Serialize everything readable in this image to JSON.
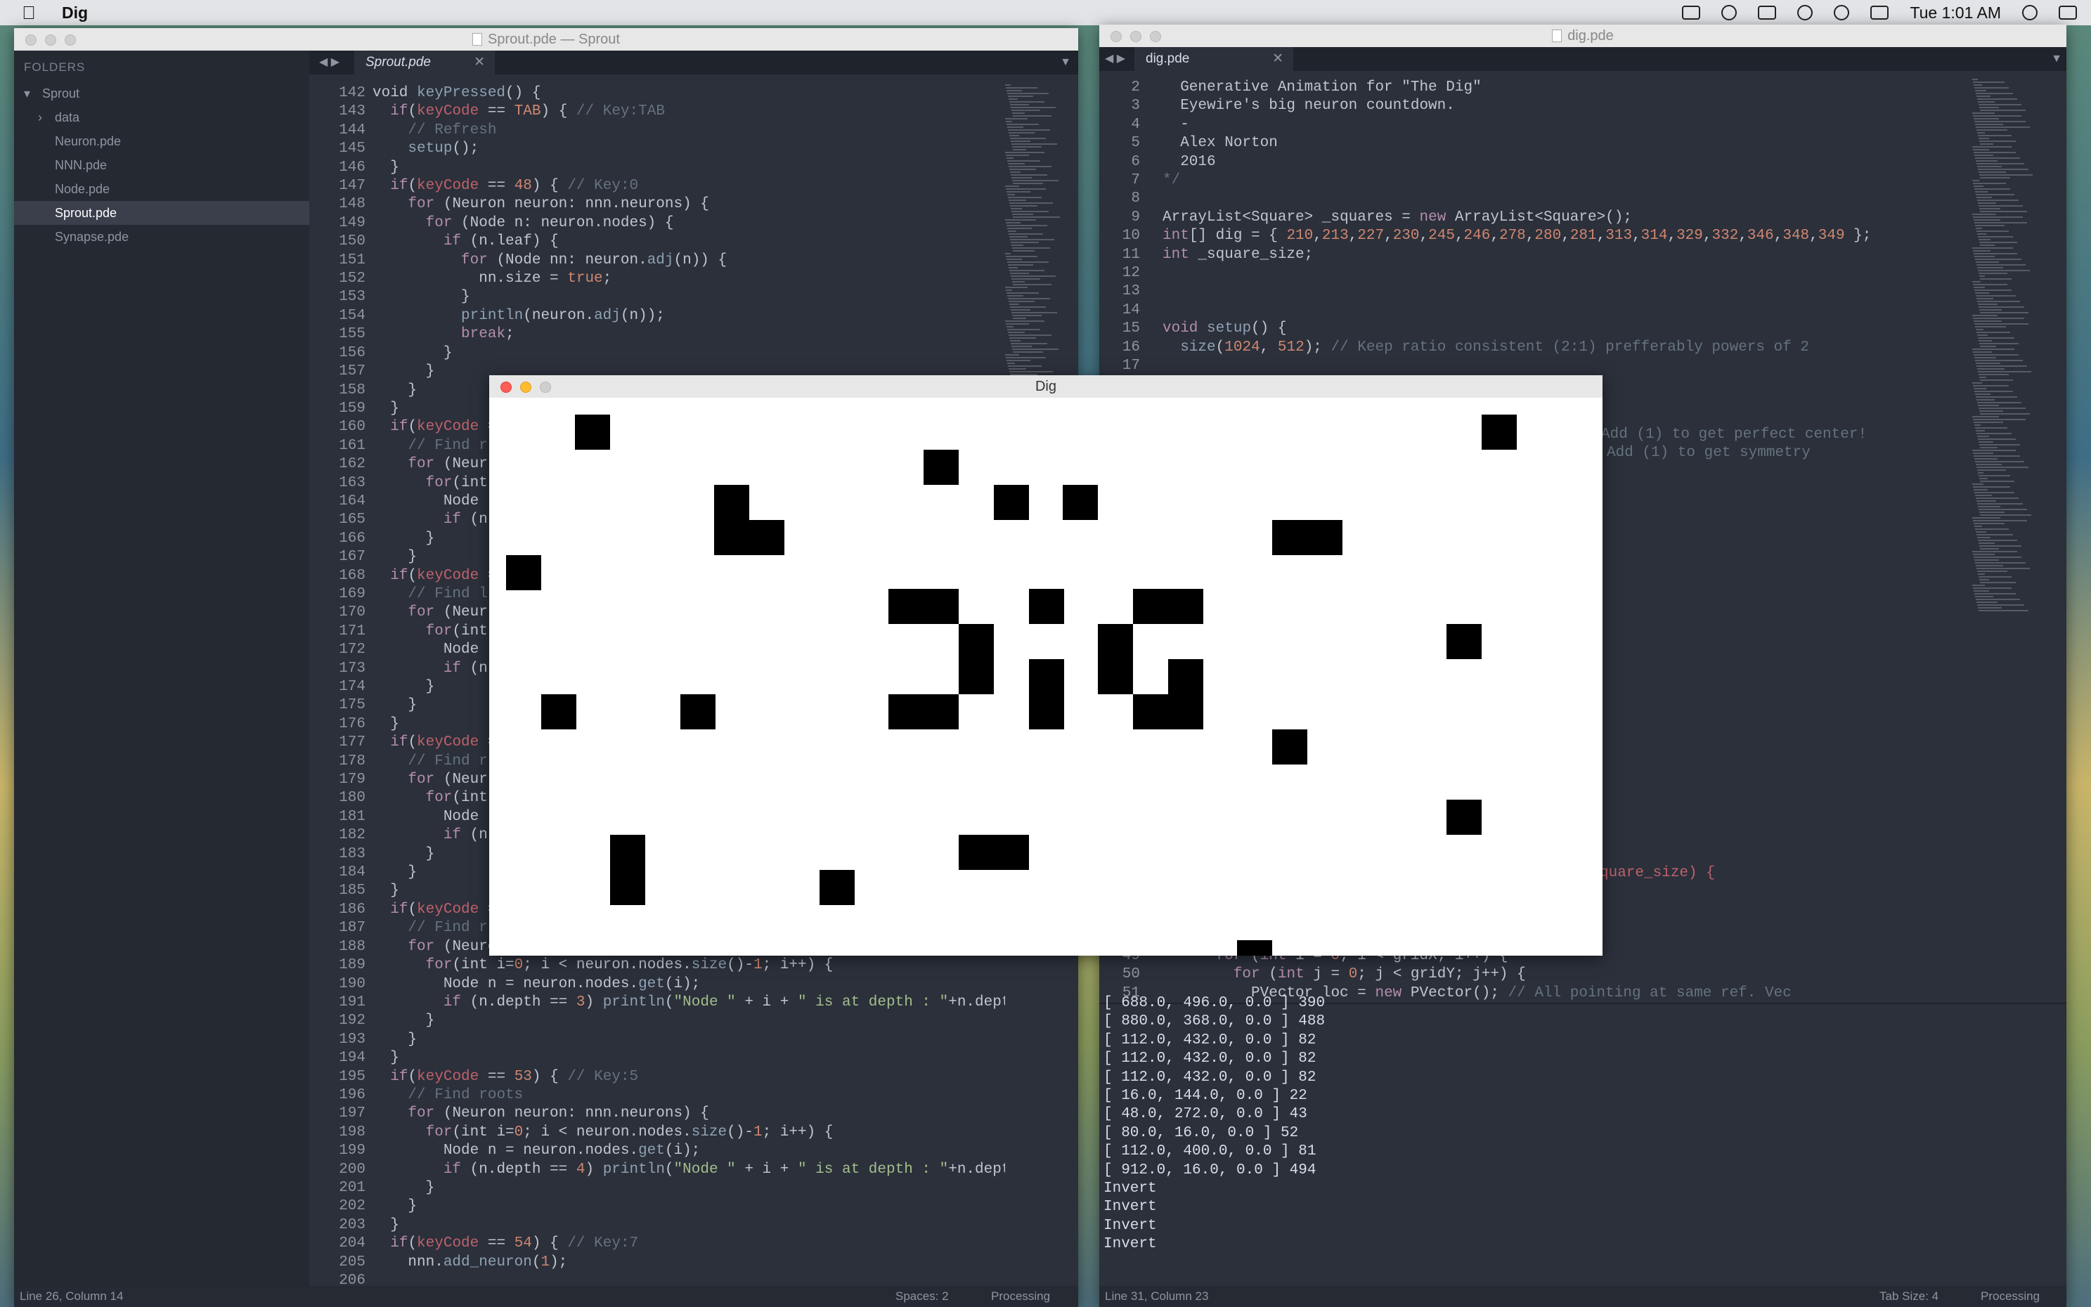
{
  "menubar": {
    "app_name": "Dig",
    "clock": "Tue 1:01 AM",
    "icons": [
      "dropbox-icon",
      "creative-cloud-icon",
      "airplay-icon",
      "bluetooth-icon",
      "wifi-icon",
      "battery-icon",
      "spotlight-icon",
      "notification-center-icon"
    ]
  },
  "sprout_window": {
    "title": "Sprout.pde — Sprout",
    "tab_label": "Sprout.pde",
    "sidebar": {
      "header": "FOLDERS",
      "project": "Sprout",
      "items": [
        "data",
        "Neuron.pde",
        "NNN.pde",
        "Node.pde",
        "Sprout.pde",
        "Synapse.pde"
      ],
      "selected": "Sprout.pde"
    },
    "line_numbers": [
      "142",
      "143",
      "144",
      "145",
      "146",
      "147",
      "148",
      "149",
      "150",
      "151",
      "152",
      "153",
      "154",
      "155",
      "156",
      "157",
      "158",
      "159",
      "160",
      "161",
      "162",
      "163",
      "164",
      "165",
      "166",
      "167",
      "168",
      "169",
      "170",
      "171",
      "172",
      "173",
      "174",
      "175",
      "176",
      "177",
      "178",
      "179",
      "180",
      "181",
      "182",
      "183",
      "184",
      "185",
      "186",
      "187",
      "188",
      "189",
      "190",
      "191",
      "192",
      "193",
      "194",
      "195",
      "196",
      "197",
      "198",
      "199",
      "200",
      "201",
      "202",
      "203",
      "204",
      "205",
      "206"
    ],
    "status_left": "Line 26, Column 14",
    "status_spaces": "Spaces: 2",
    "status_syntax": "Processing"
  },
  "dig_editor": {
    "title": "dig.pde",
    "tab_label": "dig.pde",
    "line_numbers_top": [
      "2",
      "3",
      "4",
      "5",
      "6",
      "7",
      "8",
      "9",
      "10",
      "11",
      "12",
      "13",
      "14",
      "15",
      "16",
      "17"
    ],
    "line_numbers_bottom": [
      "49",
      "50",
      "51"
    ],
    "fragment_1": "Add (1) to get perfect center!",
    "fragment_2": "Add (1) to get symmetry",
    "fragment_3": "quare_size) {",
    "console_lines": [
      "[ 688.0, 496.0, 0.0 ] 390",
      "[ 880.0, 368.0, 0.0 ] 488",
      "[ 112.0, 432.0, 0.0 ] 82",
      "[ 112.0, 432.0, 0.0 ] 82",
      "[ 112.0, 432.0, 0.0 ] 82",
      "[ 16.0, 144.0, 0.0 ] 22",
      "[ 48.0, 272.0, 0.0 ] 43",
      "[ 80.0, 16.0, 0.0 ] 52",
      "[ 112.0, 400.0, 0.0 ] 81",
      "[ 912.0, 16.0, 0.0 ] 494",
      "Invert",
      "Invert",
      "Invert",
      "Invert"
    ],
    "status_left": "Line 31, Column 23",
    "status_tab": "Tab Size: 4",
    "status_syntax": "Processing"
  },
  "dig_sketch": {
    "title": "Dig"
  }
}
